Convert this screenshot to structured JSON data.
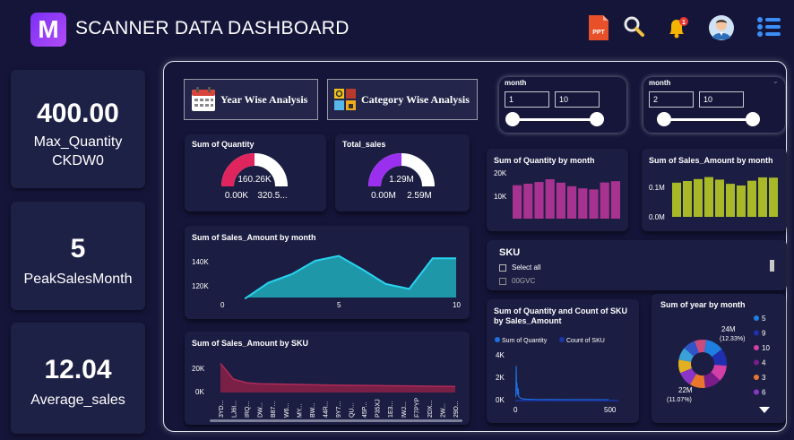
{
  "header": {
    "logo_letter": "M",
    "title": "SCANNER DATA DASHBOARD",
    "ppt_label": "PPT",
    "notification_count": "1"
  },
  "kpis": [
    {
      "value": "400.00",
      "label_line1": "Max_Quantity",
      "label_line2": "CKDW0"
    },
    {
      "value": "5",
      "label_line1": "PeakSalesMonth",
      "label_line2": ""
    },
    {
      "value": "12.04",
      "label_line1": "Average_sales",
      "label_line2": ""
    }
  ],
  "buttons": {
    "year_wise": "Year Wise Analysis",
    "category_wise": "Category Wise Analysis"
  },
  "slicers": [
    {
      "title": "month",
      "from": "1",
      "to": "10"
    },
    {
      "title": "month",
      "from": "2",
      "to": "10"
    }
  ],
  "gauges": [
    {
      "title": "Sum of Quantity",
      "value_label": "160.26K",
      "min_label": "0.00K",
      "max_label": "320.5...",
      "fraction": 0.5,
      "color": "#e0245e"
    },
    {
      "title": "Total_sales",
      "value_label": "1.29M",
      "min_label": "0.00M",
      "max_label": "2.59M",
      "fraction": 0.5,
      "color": "#9b2ff0"
    }
  ],
  "sku_slicer": {
    "title": "SKU",
    "items": [
      "Select all",
      "00GVC"
    ]
  },
  "colors": {
    "area_teal": "#1fa5b5",
    "area_line": "#29d3ef",
    "qty_bars": "#a8328f",
    "sales_bars": "#a8b827",
    "sku_area": "#7a1f45",
    "scatter_blue": "#1e6fe0"
  },
  "chart_data": [
    {
      "id": "qty_by_month",
      "type": "bar",
      "title": "Sum of Quantity by month",
      "categories": [
        "1",
        "2",
        "3",
        "4",
        "5",
        "6",
        "7",
        "8",
        "9",
        "10"
      ],
      "values": [
        15800,
        16500,
        17300,
        18600,
        17000,
        15300,
        14300,
        13800,
        17100,
        17700
      ],
      "yticks": [
        "20K",
        "10K"
      ],
      "ylim": [
        0,
        22000
      ]
    },
    {
      "id": "sales_by_month_bar",
      "type": "bar",
      "title": "Sum of Sales_Amount by month",
      "categories": [
        "1",
        "2",
        "3",
        "4",
        "5",
        "6",
        "7",
        "8",
        "9",
        "10"
      ],
      "values": [
        0.122,
        0.128,
        0.135,
        0.142,
        0.133,
        0.118,
        0.112,
        0.129,
        0.141,
        0.14
      ],
      "yticks": [
        "0.1M",
        "0.0M"
      ],
      "ylim": [
        0,
        0.16
      ]
    },
    {
      "id": "sales_by_month_area",
      "type": "area",
      "title": "Sum of Sales_Amount by month",
      "x": [
        1,
        2,
        3,
        4,
        5,
        6,
        7,
        8,
        9,
        10
      ],
      "values": [
        108000,
        121000,
        128000,
        139000,
        143000,
        132000,
        120000,
        116000,
        141000,
        141000
      ],
      "yticks": [
        "140K",
        "120K"
      ],
      "xticks": [
        "0",
        "5",
        "10"
      ],
      "ylim": [
        106000,
        150000
      ]
    },
    {
      "id": "sales_by_sku",
      "type": "area",
      "title": "Sum of Sales_Amount by SKU",
      "categories": [
        "3YD...",
        "LJ6I...",
        "IRQ...",
        "DW...",
        "B87...",
        "W6...",
        "MY...",
        "BW...",
        "44R...",
        "9Y7...",
        "QU...",
        "45P...",
        "P35XJ",
        "1E3...",
        "IWJ...",
        "F7PYP",
        "2DX...",
        "2W...",
        "29D..."
      ],
      "values": [
        24000,
        11000,
        8000,
        7200,
        7000,
        6800,
        6600,
        6400,
        6200,
        6000,
        5900,
        5800,
        5700,
        5500,
        5400,
        5300,
        5200,
        5100,
        5000
      ],
      "yticks": [
        "20K",
        "0K"
      ],
      "ylim": [
        0,
        28000
      ]
    },
    {
      "id": "qty_count_by_sales",
      "type": "line",
      "title": "Sum of Quantity and Count of SKU by Sales_Amount",
      "series": [
        {
          "name": "Sum of Quantity"
        },
        {
          "name": "Count of SKU"
        }
      ],
      "yticks": [
        "4K",
        "2K",
        "0K"
      ],
      "xticks": [
        "0",
        "500"
      ],
      "x": [
        3,
        5,
        7,
        9,
        11,
        13,
        15,
        18,
        22,
        26,
        30,
        40,
        60,
        100,
        200,
        400,
        500
      ],
      "values": [
        300,
        3100,
        900,
        1600,
        600,
        500,
        1100,
        400,
        300,
        250,
        200,
        150,
        120,
        100,
        90,
        80,
        70
      ],
      "ylim": [
        0,
        4500
      ],
      "xlim": [
        0,
        550
      ]
    },
    {
      "id": "year_by_month",
      "type": "pie",
      "title": "Sum of year by month",
      "labels": [
        "5",
        "9",
        "10",
        "4",
        "3",
        "6"
      ],
      "values": [
        12.33,
        11.5,
        11.0,
        11.07,
        10.5,
        10.0
      ],
      "colors": [
        "#1e7fe0",
        "#1f2fb0",
        "#d23fa6",
        "#7a1c8a",
        "#e8762d",
        "#8a35c8"
      ],
      "extra_colors": [
        "#e0b020",
        "#3aa0d8",
        "#2f55c8",
        "#c84b7e"
      ],
      "annotations": [
        "24M",
        "(12.33%)",
        "22M",
        "(11.07%)"
      ]
    }
  ]
}
